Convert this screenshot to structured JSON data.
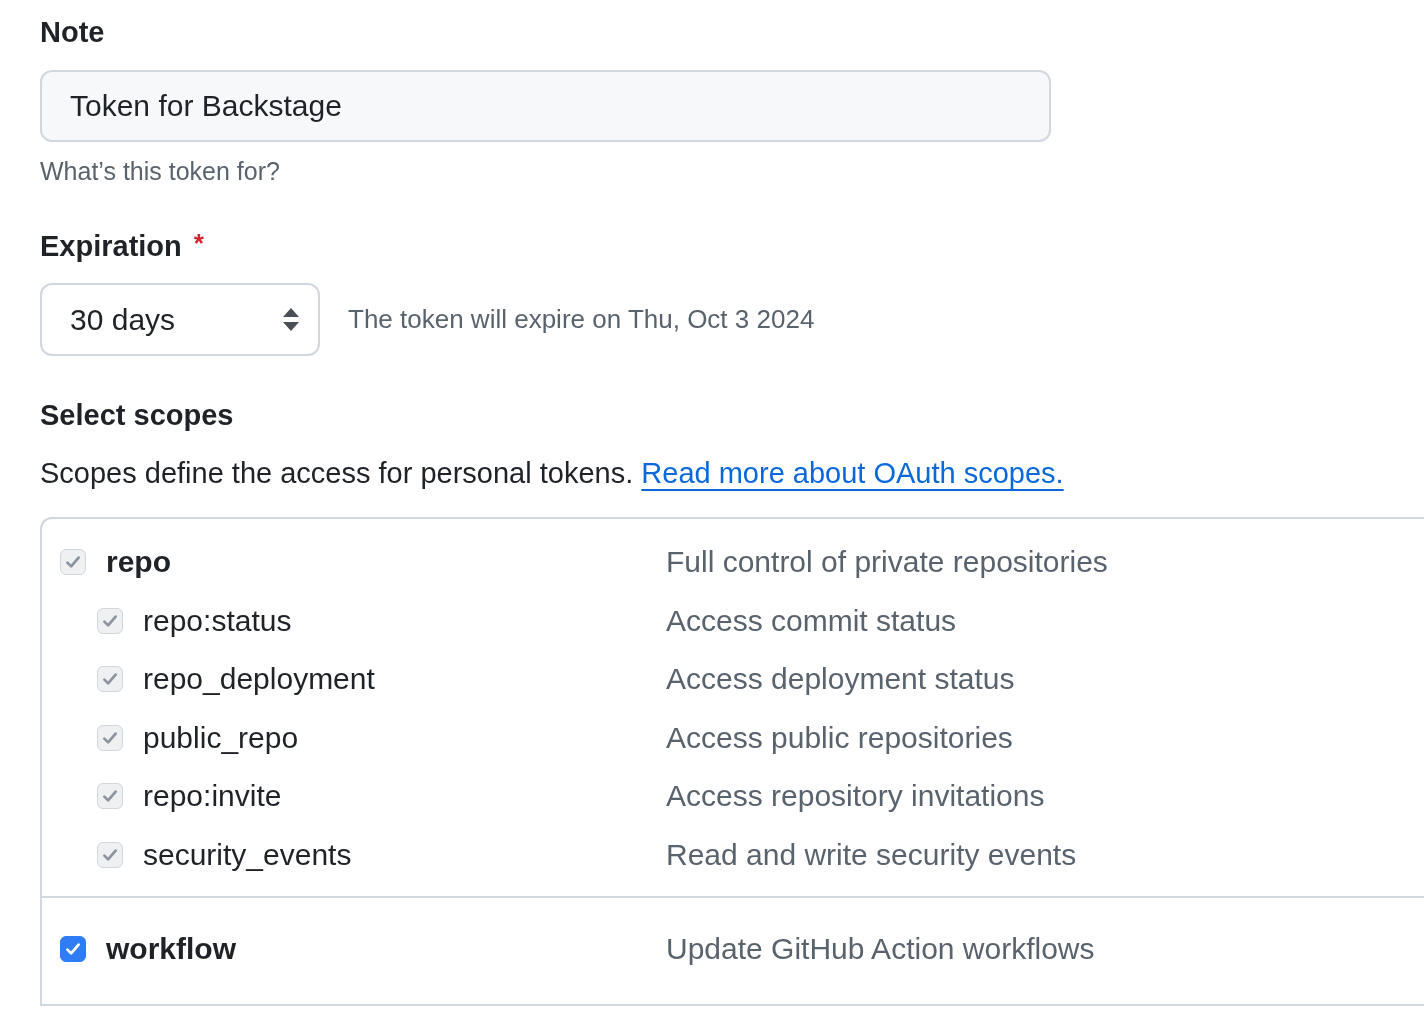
{
  "note": {
    "label": "Note",
    "value": "Token for Backstage",
    "hint": "What’s this token for?"
  },
  "expiration": {
    "label": "Expiration",
    "required_mark": "*",
    "value": "30 days",
    "info": "The token will expire on Thu, Oct 3 2024"
  },
  "scopes": {
    "heading": "Select scopes",
    "text": "Scopes define the access for personal tokens.",
    "link": "Read more about OAuth scopes.",
    "groups": [
      {
        "name": "repo",
        "description": "Full control of private repositories",
        "checked": true,
        "disabled": true,
        "children": [
          {
            "name": "repo:status",
            "description": "Access commit status",
            "checked": true,
            "disabled": true
          },
          {
            "name": "repo_deployment",
            "description": "Access deployment status",
            "checked": true,
            "disabled": true
          },
          {
            "name": "public_repo",
            "description": "Access public repositories",
            "checked": true,
            "disabled": true
          },
          {
            "name": "repo:invite",
            "description": "Access repository invitations",
            "checked": true,
            "disabled": true
          },
          {
            "name": "security_events",
            "description": "Read and write security events",
            "checked": true,
            "disabled": true
          }
        ]
      },
      {
        "name": "workflow",
        "description": "Update GitHub Action workflows",
        "checked": true,
        "disabled": false
      }
    ]
  }
}
